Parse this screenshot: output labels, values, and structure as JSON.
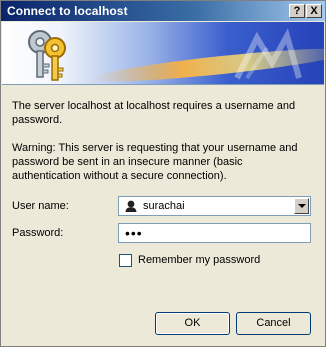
{
  "window": {
    "title": "Connect to localhost",
    "help_button": "?",
    "close_button": "X"
  },
  "banner": {
    "icon": "keys-icon"
  },
  "message": {
    "line1": "The server localhost at localhost requires a username and password.",
    "warning": "Warning: This server is requesting that your username and password be sent in an insecure manner (basic authentication without a secure connection)."
  },
  "form": {
    "username_label": "User name:",
    "username_value": "surachai",
    "username_icon": "user-icon",
    "password_label": "Password:",
    "password_value": "•••",
    "remember_label": "Remember my password",
    "remember_checked": false
  },
  "buttons": {
    "ok": "OK",
    "cancel": "Cancel"
  }
}
